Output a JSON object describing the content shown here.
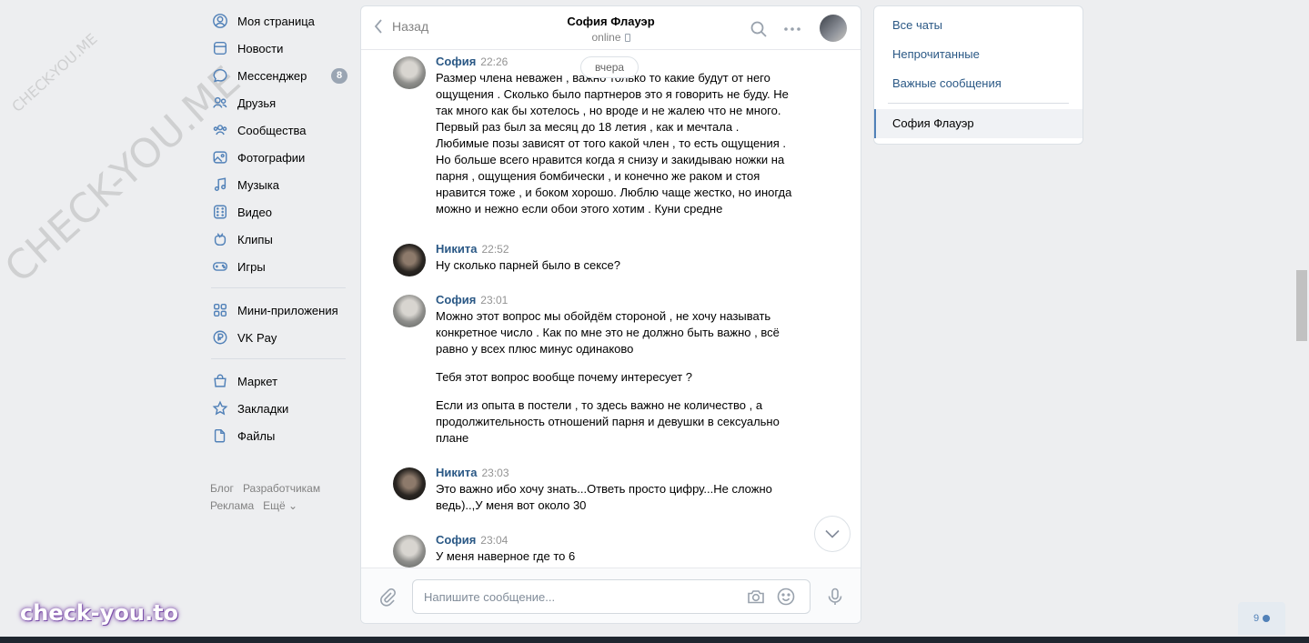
{
  "nav": {
    "items": [
      {
        "label": "Моя страница",
        "icon": "user-icon"
      },
      {
        "label": "Новости",
        "icon": "news-icon"
      },
      {
        "label": "Мессенджер",
        "icon": "message-icon",
        "badge": "8"
      },
      {
        "label": "Друзья",
        "icon": "friends-icon"
      },
      {
        "label": "Сообщества",
        "icon": "communities-icon"
      },
      {
        "label": "Фотографии",
        "icon": "photo-icon"
      },
      {
        "label": "Музыка",
        "icon": "music-icon"
      },
      {
        "label": "Видео",
        "icon": "video-icon"
      },
      {
        "label": "Клипы",
        "icon": "clips-icon"
      },
      {
        "label": "Игры",
        "icon": "gamepad-icon"
      },
      {
        "label": "Мини-приложения",
        "icon": "apps-icon"
      },
      {
        "label": "VK Pay",
        "icon": "vkpay-icon"
      },
      {
        "label": "Маркет",
        "icon": "market-icon"
      },
      {
        "label": "Закладки",
        "icon": "star-icon"
      },
      {
        "label": "Файлы",
        "icon": "file-icon"
      }
    ],
    "footer": {
      "blog": "Блог",
      "developers": "Разработчикам",
      "ads": "Реклама",
      "more": "Ещё ⌄"
    }
  },
  "chat": {
    "back_label": "Назад",
    "peer_name": "София Флауэр",
    "peer_status": "online",
    "date_separator": "вчера",
    "messages": [
      {
        "author": "София",
        "time": "22:26",
        "avatar": "sofia",
        "paragraphs": [
          "Размер члена неважен , важно только то какие будут от него ощущения . Сколько было партнеров это я говорить не буду. Не так много как бы хотелось , но вроде и не жалею что не много. Первый раз был за месяц до 18 летия , как и мечтала . Любимые позы зависят от того какой член , то есть ощущения . Но больше всего нравится когда я снизу и закидываю ножки на парня , ощущения бомбически , и конечно же раком и стоя нравится тоже , и боком хорошо. Люблю чаще жестко, но иногда можно и нежно если обои этого хотим . Куни средне"
        ]
      },
      {
        "author": "Никита",
        "time": "22:52",
        "avatar": "nikita",
        "paragraphs": [
          "Ну сколько парней было в сексе?"
        ]
      },
      {
        "author": "София",
        "time": "23:01",
        "avatar": "sofia",
        "paragraphs": [
          "Можно этот вопрос мы обойдём стороной , не хочу называть конкретное число . Как по мне это не должно быть важно , всё равно у всех плюс минус одинаково",
          "Тебя этот вопрос вообще почему интересует ?",
          "Если из опыта в постели , то здесь важно не количество , а продолжительность отношений парня и девушки в сексуально плане"
        ]
      },
      {
        "author": "Никита",
        "time": "23:03",
        "avatar": "nikita",
        "paragraphs": [
          "Это важно ибо хочу знать...Ответь просто цифру...Не сложно ведь)..,У меня вот около 30"
        ]
      },
      {
        "author": "София",
        "time": "23:04",
        "avatar": "sofia",
        "paragraphs": [
          "У меня наверное где то 6"
        ]
      }
    ],
    "composer": {
      "placeholder": "Напишите сообщение..."
    }
  },
  "right_panel": {
    "items": [
      "Все чаты",
      "Непрочитанные",
      "Важные сообщения"
    ],
    "active_chat": "София Флауэр"
  },
  "watermarks": {
    "small": "CHECK-YOU.ME",
    "large": "CHECK-YOU.ME",
    "brand": "check-you.to"
  },
  "online_counter": "9",
  "colors": {
    "accent": "#5181b8",
    "link": "#2a5885",
    "background": "#edeef0"
  }
}
